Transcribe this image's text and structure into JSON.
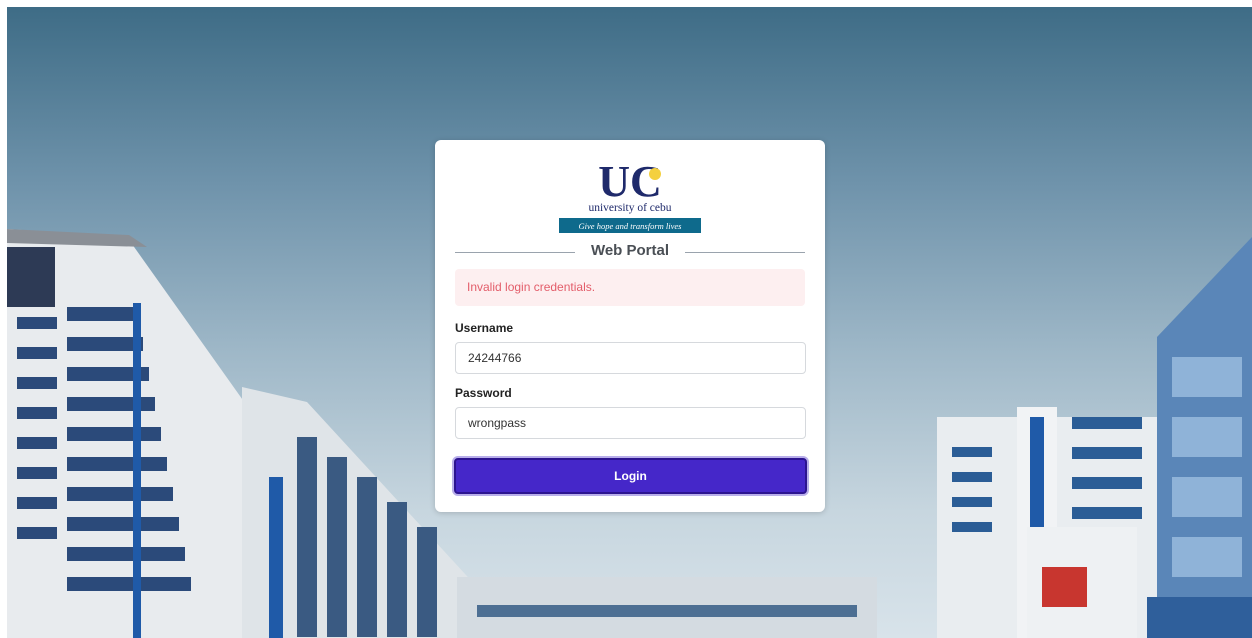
{
  "logo": {
    "monogram": "UC",
    "name": "university of cebu",
    "tagline": "Give hope and transform lives"
  },
  "portal": {
    "title": "Web Portal"
  },
  "alert": {
    "message": "Invalid login credentials."
  },
  "form": {
    "username_label": "Username",
    "username_value": "24244766",
    "password_label": "Password",
    "password_value": "wrongpass",
    "login_label": "Login"
  },
  "colors": {
    "button": "#4527c9",
    "alert_bg": "#fdeff0",
    "alert_text": "#e35d6a",
    "brand_navy": "#1f2a6b",
    "brand_teal": "#0e6a8c"
  }
}
